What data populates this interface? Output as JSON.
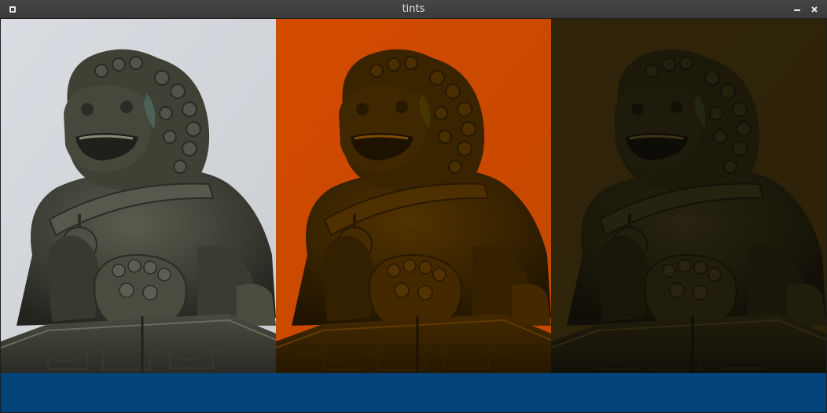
{
  "window": {
    "title": "tints"
  },
  "titlebar_icons": {
    "menu": "window-menu-icon",
    "minimize": "minimize-icon",
    "close": "close-icon"
  },
  "panels": [
    {
      "name": "original",
      "tint": null,
      "sky": "#d9dde2"
    },
    {
      "name": "orange-tint",
      "tint": "#e88a00",
      "sky": "#e88a00"
    },
    {
      "name": "olive-tint",
      "tint": "#6e6030",
      "sky": "#6e6030"
    }
  ],
  "bottom_bar_color": "#02447a"
}
